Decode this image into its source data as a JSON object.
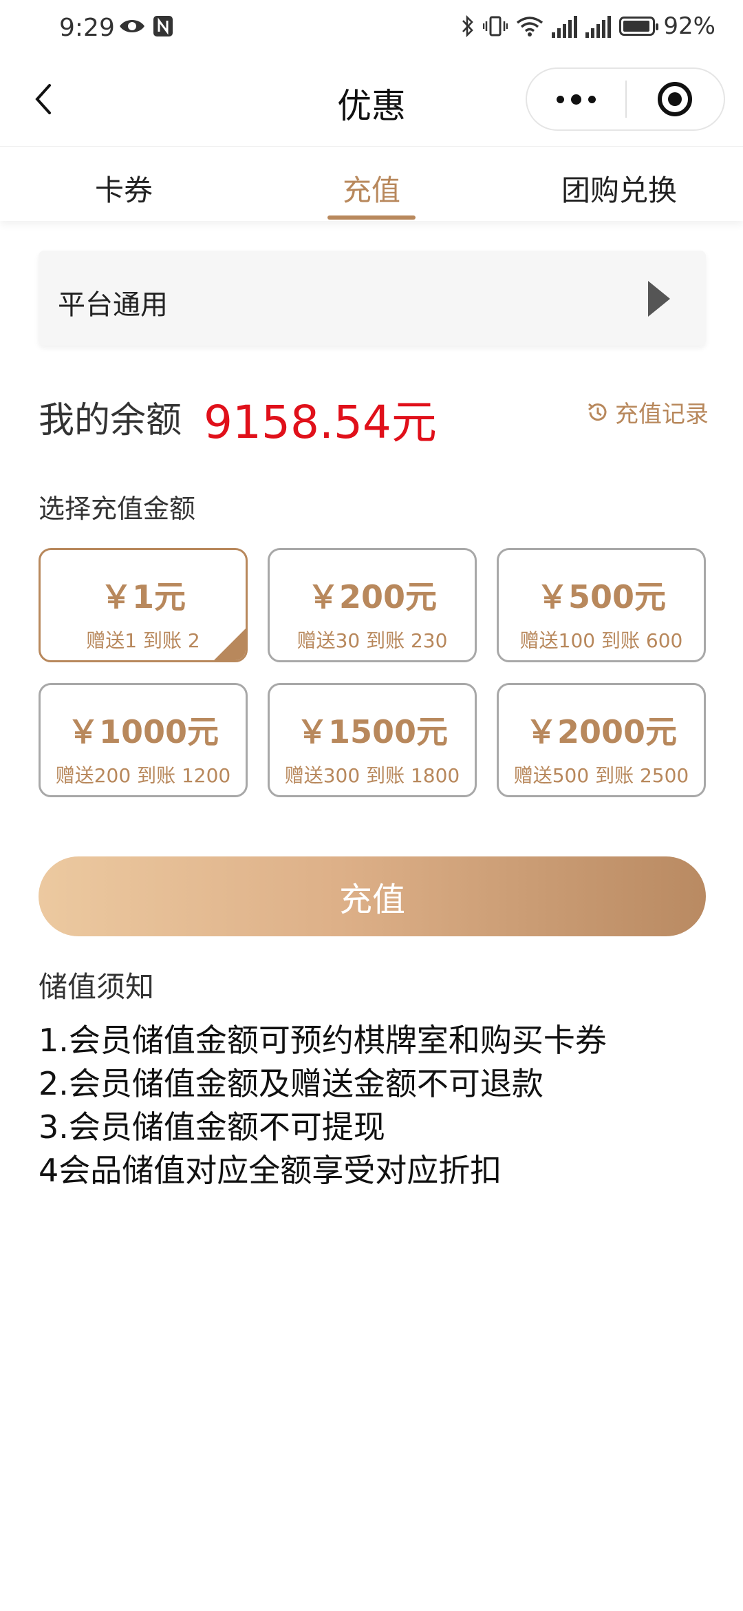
{
  "status_bar": {
    "time": "9:29",
    "battery": "92%",
    "signal_1_label": "4G",
    "signal_2_label": "4G"
  },
  "nav": {
    "title": "优惠"
  },
  "tabs": [
    {
      "label": "卡券"
    },
    {
      "label": "充值"
    },
    {
      "label": "团购兑换"
    }
  ],
  "scope": {
    "label": "平台通用"
  },
  "balance": {
    "label": "我的余额",
    "value": "9158.54元"
  },
  "history": {
    "label": "充值记录"
  },
  "section": {
    "label": "选择充值金额"
  },
  "amounts": [
    {
      "main": "￥1元",
      "sub": "赠送1 到账 2",
      "selected": true
    },
    {
      "main": "￥200元",
      "sub": "赠送30 到账 230"
    },
    {
      "main": "￥500元",
      "sub": "赠送100 到账 600"
    },
    {
      "main": "￥1000元",
      "sub": "赠送200 到账 1200"
    },
    {
      "main": "￥1500元",
      "sub": "赠送300 到账 1800"
    },
    {
      "main": "￥2000元",
      "sub": "赠送500 到账 2500"
    }
  ],
  "charge_button": {
    "label": "充值"
  },
  "notice": {
    "title": "储值须知",
    "items": [
      "1.会员储值金额可预约棋牌室和购买卡券",
      "2.会员储值金额及赠送金额不可退款",
      "3.会员储值金额不可提现",
      "4会品储值对应全额享受对应折扣"
    ]
  },
  "colors": {
    "accent": "#b8885c",
    "balance": "#e0101a"
  }
}
